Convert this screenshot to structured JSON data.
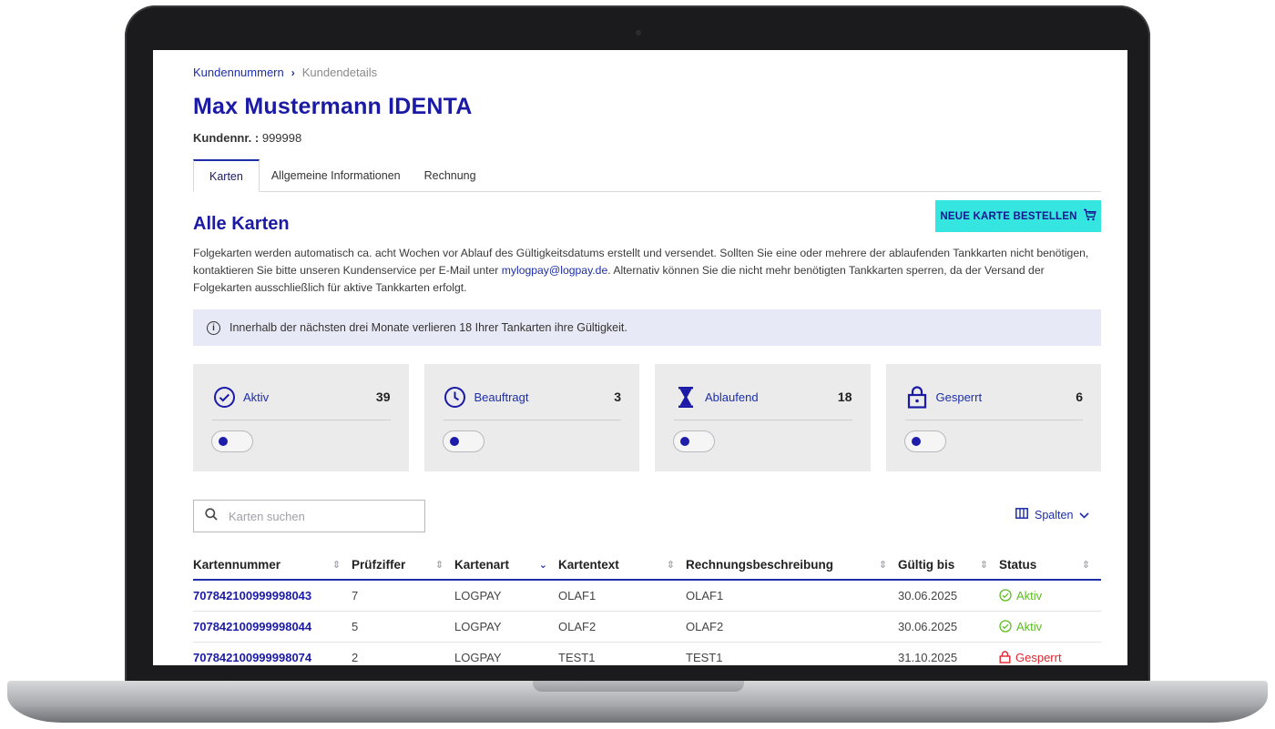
{
  "breadcrumb": {
    "link": "Kundennummern",
    "separator": "›",
    "current": "Kundendetails"
  },
  "page": {
    "title": "Max Mustermann IDENTA",
    "customer_label": "Kundennr. :",
    "customer_no": "999998"
  },
  "tabs": [
    {
      "label": "Karten"
    },
    {
      "label": "Allgemeine Informationen"
    },
    {
      "label": "Rechnung"
    }
  ],
  "order_button": {
    "label": "NEUE KARTE BESTELLEN",
    "icon": "cart-icon"
  },
  "section": {
    "title": "Alle Karten",
    "desc_before": "Folgekarten werden automatisch ca. acht Wochen vor Ablauf des Gültigkeitsdatums erstellt und versendet. Sollten Sie eine oder mehrere der ablaufenden Tankkarten nicht benötigen, kontaktieren Sie bitte unseren Kundenservice per E-Mail unter ",
    "desc_mail": "mylogpay@logpay.de",
    "desc_after": ". Alternativ können Sie die nicht mehr benötigten Tankkarten sperren, da der Versand der Folgekarten ausschließlich für aktive Tankkarten erfolgt."
  },
  "info_banner": {
    "icon": "info-icon",
    "text": "Innerhalb der nächsten drei Monate verlieren 18 Ihrer Tankarten ihre Gültigkeit."
  },
  "stats": [
    {
      "label": "Aktiv",
      "count": "39",
      "icon": "check-circle-icon",
      "toggle_on": false
    },
    {
      "label": "Beauftragt",
      "count": "3",
      "icon": "clock-icon",
      "toggle_on": false
    },
    {
      "label": "Ablaufend",
      "count": "18",
      "icon": "hourglass-icon",
      "toggle_on": false
    },
    {
      "label": "Gesperrt",
      "count": "6",
      "icon": "lock-icon",
      "toggle_on": false
    }
  ],
  "search": {
    "placeholder": "Karten suchen",
    "value": ""
  },
  "columns_button": {
    "label": "Spalten"
  },
  "table": {
    "headers": [
      "Kartennummer",
      "Prüfziffer",
      "Kartenart",
      "Kartentext",
      "Rechnungsbeschreibung",
      "Gültig bis",
      "Status"
    ],
    "rows": [
      {
        "number": "707842100999998043",
        "check": "7",
        "type": "LOGPAY",
        "text": "OLAF1",
        "billing": "OLAF1",
        "valid": "30.06.2025",
        "status": "Aktiv"
      },
      {
        "number": "707842100999998044",
        "check": "5",
        "type": "LOGPAY",
        "text": "OLAF2",
        "billing": "OLAF2",
        "valid": "30.06.2025",
        "status": "Aktiv"
      },
      {
        "number": "707842100999998074",
        "check": "2",
        "type": "LOGPAY",
        "text": "TEST1",
        "billing": "TEST1",
        "valid": "31.10.2025",
        "status": "Gesperrt"
      }
    ]
  },
  "colors": {
    "brand_blue": "#1a1aa6",
    "accent_cyan": "#34e5e0",
    "ok_green": "#5bbd1f",
    "blocked_red": "#e0252e"
  }
}
